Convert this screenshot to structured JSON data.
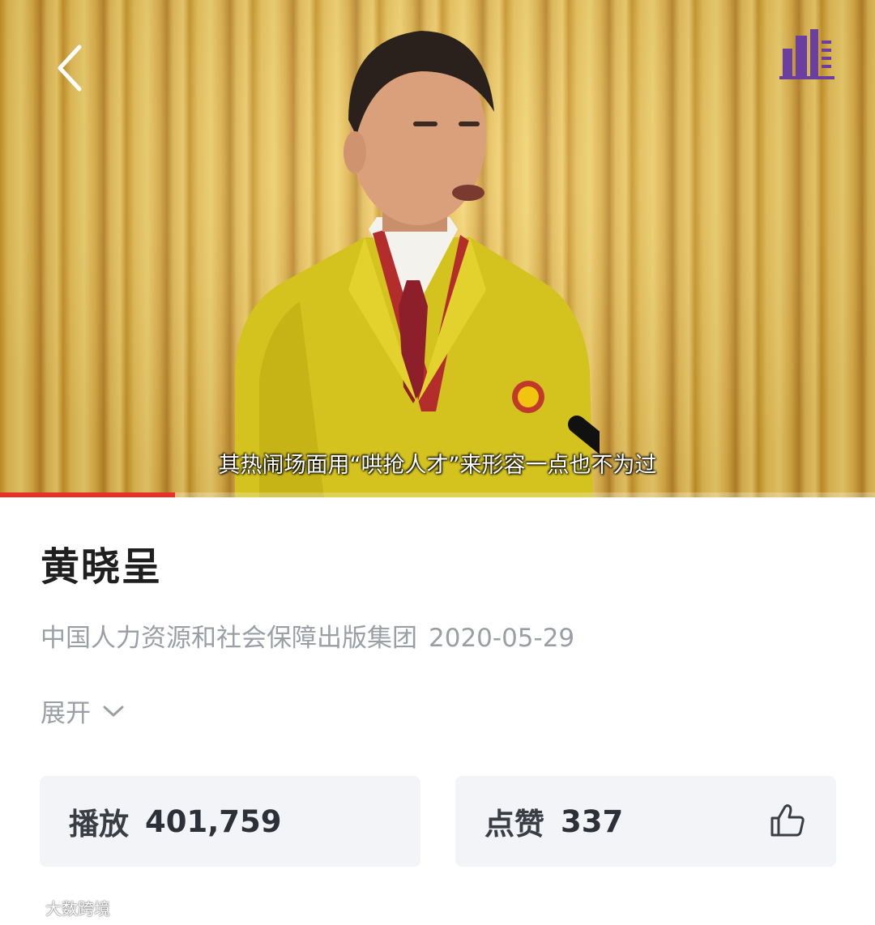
{
  "video": {
    "subtitle": "其热闹场面用“哄抢人才”来形容一点也不为过",
    "progress_fraction": 0.2
  },
  "info": {
    "title": "黄晓呈",
    "publisher": "中国人力资源和社会保障出版集团",
    "date": "2020-05-29",
    "expand_label": "展开"
  },
  "stats": {
    "plays_label": "播放",
    "plays_value": "401,759",
    "likes_label": "点赞",
    "likes_value": "337"
  },
  "watermark": {
    "text": "大数跨境"
  },
  "icons": {
    "back": "chevron-left-icon",
    "logo": "building-logo-icon",
    "expand": "chevron-down-icon",
    "like": "thumbs-up-icon"
  },
  "colors": {
    "progress": "#e4322b",
    "card_bg": "#f3f4f7",
    "meta_text": "#9a9fa6"
  }
}
